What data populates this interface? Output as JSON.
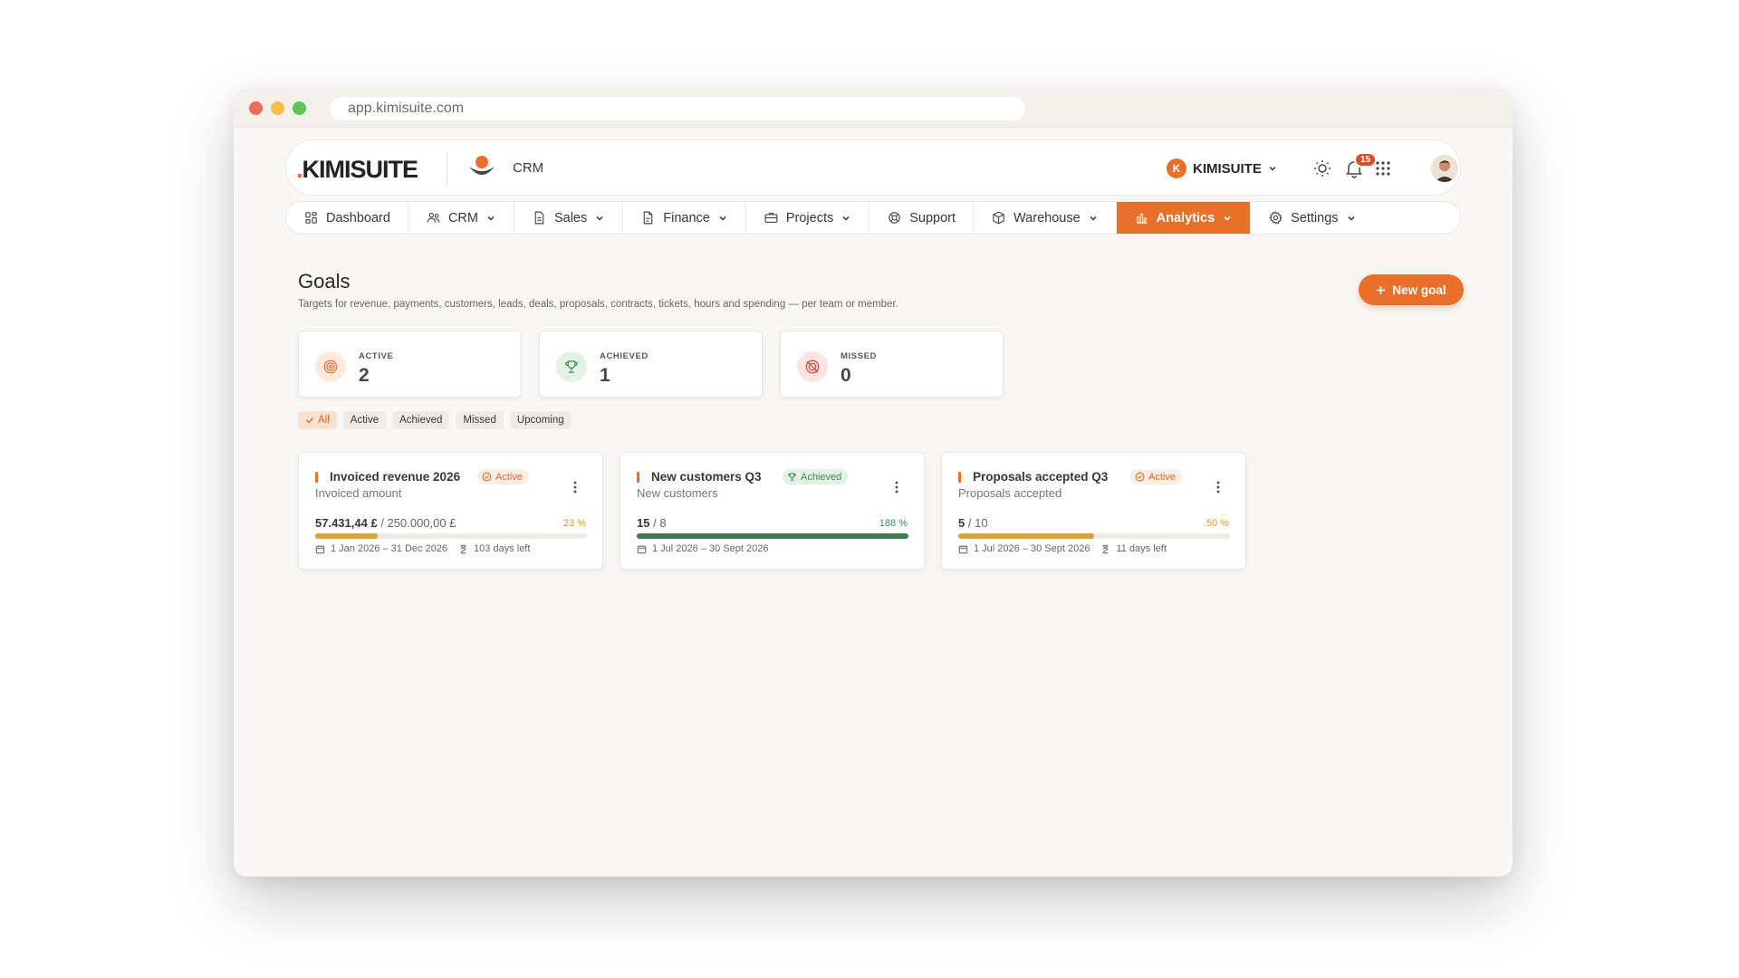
{
  "browser": {
    "url": "app.kimisuite.com"
  },
  "header": {
    "logo_dot": ".",
    "logo_text": "KIMISUITE",
    "module_label": "CRM",
    "org_initial": "K",
    "org_name": "KIMISUITE",
    "notification_count": "15",
    "icons": [
      "sun-icon",
      "bell-icon",
      "apps-grid-icon",
      "user-avatar"
    ]
  },
  "nav": {
    "items": [
      {
        "label": "Dashboard",
        "icon": "dashboard-icon",
        "has_dropdown": false
      },
      {
        "label": "CRM",
        "icon": "users-icon",
        "has_dropdown": true
      },
      {
        "label": "Sales",
        "icon": "document-icon",
        "has_dropdown": true
      },
      {
        "label": "Finance",
        "icon": "file-icon",
        "has_dropdown": true
      },
      {
        "label": "Projects",
        "icon": "briefcase-icon",
        "has_dropdown": true
      },
      {
        "label": "Support",
        "icon": "lifebuoy-icon",
        "has_dropdown": false
      },
      {
        "label": "Warehouse",
        "icon": "box-icon",
        "has_dropdown": true
      },
      {
        "label": "Analytics",
        "icon": "bar-chart-icon",
        "has_dropdown": true,
        "active": true
      },
      {
        "label": "Settings",
        "icon": "gear-icon",
        "has_dropdown": true
      }
    ]
  },
  "page": {
    "title": "Goals",
    "subtitle": "Targets for revenue, payments, customers, leads, deals, proposals, contracts, tickets, hours and spending — per team or member.",
    "new_goal_label": "New goal"
  },
  "stats": [
    {
      "label": "ACTIVE",
      "value": "2",
      "icon": "target-icon",
      "color": "#e8702a"
    },
    {
      "label": "ACHIEVED",
      "value": "1",
      "icon": "trophy-icon",
      "color": "#3e8a57"
    },
    {
      "label": "MISSED",
      "value": "0",
      "icon": "target-off-icon",
      "color": "#d0453a"
    }
  ],
  "filters": {
    "chips": [
      "All",
      "Active",
      "Achieved",
      "Missed",
      "Upcoming"
    ],
    "selected": "All"
  },
  "goals": [
    {
      "title": "Invoiced revenue 2026",
      "status": "Active",
      "metric": "Invoiced amount",
      "current": "57.431,44 £",
      "target": "/ 250.000,00 £",
      "percent_label": "23 %",
      "progress": 0.23,
      "bar_color": "#dba23a",
      "pct_color": "#d49a2f",
      "period": "1 Jan 2026 – 31 Dec 2026",
      "remaining": "103 days left"
    },
    {
      "title": "New customers Q3",
      "status": "Achieved",
      "metric": "New customers",
      "current": "15",
      "target": "/ 8",
      "percent_label": "188 %",
      "progress": 1.0,
      "bar_color": "#3e7a52",
      "pct_color": "#3e8a57",
      "period": "1 Jul 2026 – 30 Sept 2026",
      "remaining": ""
    },
    {
      "title": "Proposals accepted Q3",
      "status": "Active",
      "metric": "Proposals accepted",
      "current": "5",
      "target": "/ 10",
      "percent_label": "50 %",
      "progress": 0.5,
      "bar_color": "#dba23a",
      "pct_color": "#d49a2f",
      "period": "1 Jul 2026 – 30 Sept 2026",
      "remaining": "11 days left"
    }
  ],
  "colors": {
    "accent": "#e8702a",
    "success": "#3e8a57",
    "danger": "#d0453a"
  }
}
